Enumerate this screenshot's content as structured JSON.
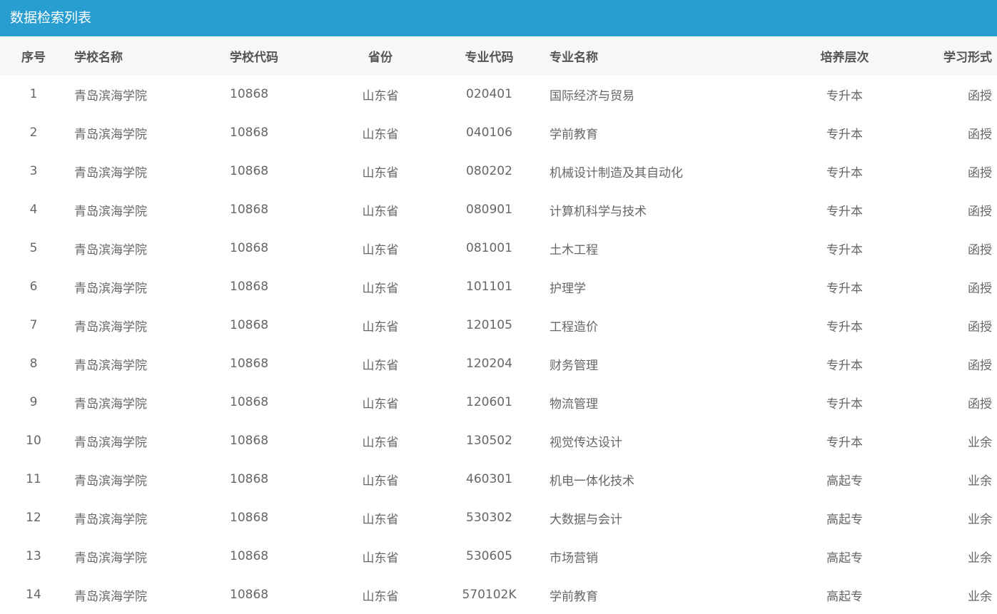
{
  "panel": {
    "title": "数据检索列表"
  },
  "table": {
    "headers": {
      "index": "序号",
      "school_name": "学校名称",
      "school_code": "学校代码",
      "province": "省份",
      "major_code": "专业代码",
      "major_name": "专业名称",
      "level": "培养层次",
      "study_form": "学习形式"
    },
    "rows": [
      {
        "index": "1",
        "school_name": "青岛滨海学院",
        "school_code": "10868",
        "province": "山东省",
        "major_code": "020401",
        "major_name": "国际经济与贸易",
        "level": "专升本",
        "study_form": "函授"
      },
      {
        "index": "2",
        "school_name": "青岛滨海学院",
        "school_code": "10868",
        "province": "山东省",
        "major_code": "040106",
        "major_name": "学前教育",
        "level": "专升本",
        "study_form": "函授"
      },
      {
        "index": "3",
        "school_name": "青岛滨海学院",
        "school_code": "10868",
        "province": "山东省",
        "major_code": "080202",
        "major_name": "机械设计制造及其自动化",
        "level": "专升本",
        "study_form": "函授"
      },
      {
        "index": "4",
        "school_name": "青岛滨海学院",
        "school_code": "10868",
        "province": "山东省",
        "major_code": "080901",
        "major_name": "计算机科学与技术",
        "level": "专升本",
        "study_form": "函授"
      },
      {
        "index": "5",
        "school_name": "青岛滨海学院",
        "school_code": "10868",
        "province": "山东省",
        "major_code": "081001",
        "major_name": "土木工程",
        "level": "专升本",
        "study_form": "函授"
      },
      {
        "index": "6",
        "school_name": "青岛滨海学院",
        "school_code": "10868",
        "province": "山东省",
        "major_code": "101101",
        "major_name": "护理学",
        "level": "专升本",
        "study_form": "函授"
      },
      {
        "index": "7",
        "school_name": "青岛滨海学院",
        "school_code": "10868",
        "province": "山东省",
        "major_code": "120105",
        "major_name": "工程造价",
        "level": "专升本",
        "study_form": "函授"
      },
      {
        "index": "8",
        "school_name": "青岛滨海学院",
        "school_code": "10868",
        "province": "山东省",
        "major_code": "120204",
        "major_name": "财务管理",
        "level": "专升本",
        "study_form": "函授"
      },
      {
        "index": "9",
        "school_name": "青岛滨海学院",
        "school_code": "10868",
        "province": "山东省",
        "major_code": "120601",
        "major_name": "物流管理",
        "level": "专升本",
        "study_form": "函授"
      },
      {
        "index": "10",
        "school_name": "青岛滨海学院",
        "school_code": "10868",
        "province": "山东省",
        "major_code": "130502",
        "major_name": "视觉传达设计",
        "level": "专升本",
        "study_form": "业余"
      },
      {
        "index": "11",
        "school_name": "青岛滨海学院",
        "school_code": "10868",
        "province": "山东省",
        "major_code": "460301",
        "major_name": "机电一体化技术",
        "level": "高起专",
        "study_form": "业余"
      },
      {
        "index": "12",
        "school_name": "青岛滨海学院",
        "school_code": "10868",
        "province": "山东省",
        "major_code": "530302",
        "major_name": "大数据与会计",
        "level": "高起专",
        "study_form": "业余"
      },
      {
        "index": "13",
        "school_name": "青岛滨海学院",
        "school_code": "10868",
        "province": "山东省",
        "major_code": "530605",
        "major_name": "市场营销",
        "level": "高起专",
        "study_form": "业余"
      },
      {
        "index": "14",
        "school_name": "青岛滨海学院",
        "school_code": "10868",
        "province": "山东省",
        "major_code": "570102K",
        "major_name": "学前教育",
        "level": "高起专",
        "study_form": "业余"
      }
    ]
  }
}
